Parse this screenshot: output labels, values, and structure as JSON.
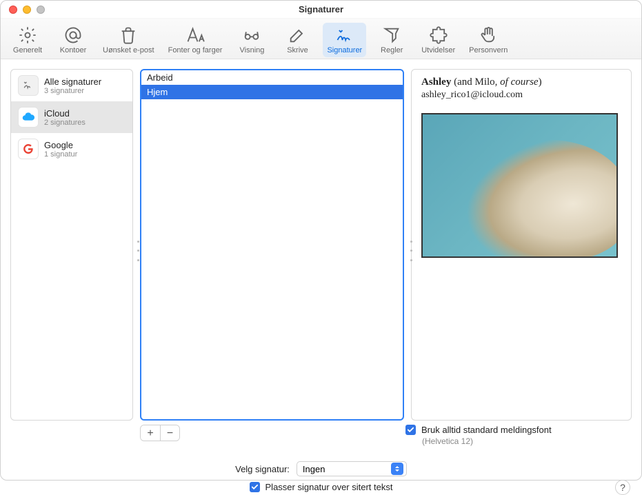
{
  "window": {
    "title": "Signaturer"
  },
  "toolbar": {
    "items": [
      {
        "id": "general",
        "label": "Generelt"
      },
      {
        "id": "accounts",
        "label": "Kontoer"
      },
      {
        "id": "junk",
        "label": "Uønsket e-post"
      },
      {
        "id": "fonts",
        "label": "Fonter og farger"
      },
      {
        "id": "viewing",
        "label": "Visning"
      },
      {
        "id": "composing",
        "label": "Skrive"
      },
      {
        "id": "signatures",
        "label": "Signaturer",
        "active": true
      },
      {
        "id": "rules",
        "label": "Regler"
      },
      {
        "id": "extensions",
        "label": "Utvidelser"
      },
      {
        "id": "privacy",
        "label": "Personvern"
      }
    ]
  },
  "accounts": [
    {
      "name": "Alle signaturer",
      "sub": "3 signaturer",
      "icon": "signature",
      "selected": false
    },
    {
      "name": "iCloud",
      "sub": "2 signatures",
      "icon": "icloud",
      "selected": true
    },
    {
      "name": "Google",
      "sub": "1 signatur",
      "icon": "google",
      "selected": false
    }
  ],
  "signatures": [
    {
      "label": "Arbeid",
      "selected": false
    },
    {
      "label": "Hjem",
      "selected": true
    }
  ],
  "preview": {
    "name_bold": "Ashley",
    "name_paren1": " (and Milo, ",
    "name_italic": "of course",
    "name_paren2": ")",
    "email": "ashley_rico1@icloud.com",
    "image_alt": "Afghan hound dog with windblown fur against teal background"
  },
  "buttons": {
    "add": "+",
    "remove": "−"
  },
  "options": {
    "use_default_font_label": "Bruk alltid standard meldingsfont",
    "use_default_font_sub": "(Helvetica 12)",
    "use_default_font_checked": true,
    "choose_signature_label": "Velg signatur:",
    "choose_signature_value": "Ingen",
    "place_above_quoted_label": "Plasser signatur over sitert tekst",
    "place_above_quoted_checked": true
  },
  "help": "?"
}
